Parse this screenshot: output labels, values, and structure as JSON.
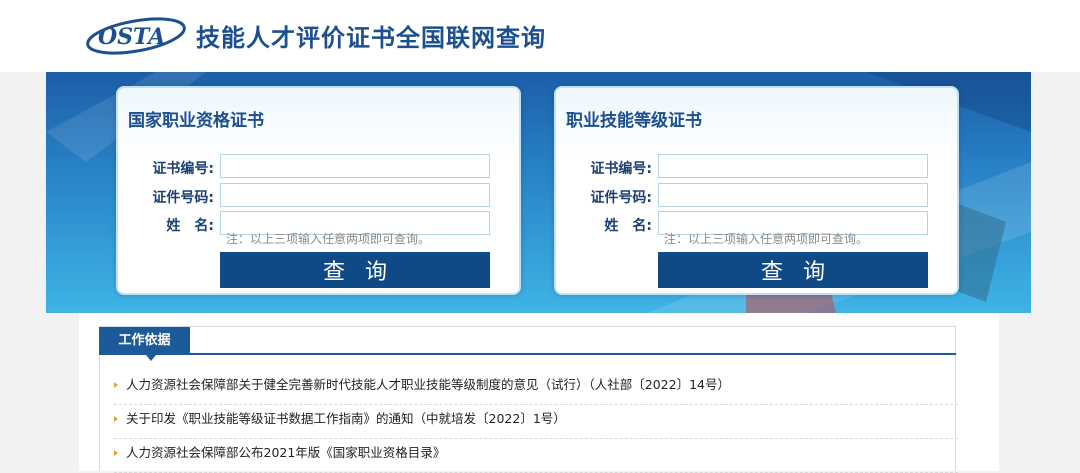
{
  "header": {
    "logo_text": "OSTA",
    "site_title": "技能人才评价证书全国联网查询"
  },
  "forms": [
    {
      "title": "国家职业资格证书",
      "fields": [
        {
          "label": "证书编号:",
          "value": ""
        },
        {
          "label": "证件号码:",
          "value": ""
        },
        {
          "label": "姓　名:",
          "value": ""
        }
      ],
      "note": "注：以上三项输入任意两项即可查询。",
      "button": "查询"
    },
    {
      "title": "职业技能等级证书",
      "fields": [
        {
          "label": "证书编号:",
          "value": ""
        },
        {
          "label": "证件号码:",
          "value": ""
        },
        {
          "label": "姓　名:",
          "value": ""
        }
      ],
      "note": "注：以上三项输入任意两项即可查询。",
      "button": "查询"
    }
  ],
  "basis": {
    "tab_label": "工作依据",
    "items": [
      "人力资源社会保障部关于健全完善新时代技能人才职业技能等级制度的意见（试行）（人社部〔2022〕14号）",
      "关于印发《职业技能等级证书数据工作指南》的通知（中就培发〔2022〕1号）",
      "人力资源社会保障部公布2021年版《国家职业资格目录》"
    ]
  },
  "colors": {
    "brand_blue": "#1c4f8f",
    "button_blue": "#0f4a86",
    "bullet_orange": "#f0a020"
  }
}
